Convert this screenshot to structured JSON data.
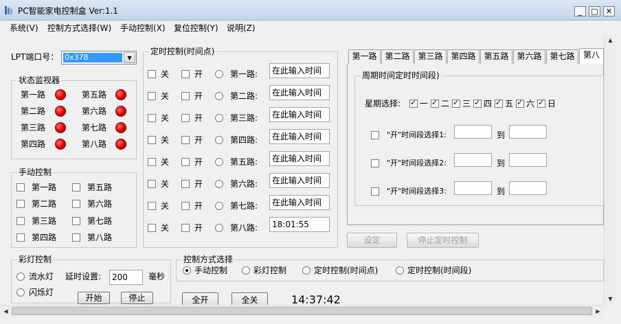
{
  "window": {
    "title": "PC智能家电控制盒  Ver:1.1",
    "minimize_icon": "minimize-icon",
    "maximize_icon": "maximize-icon",
    "close_icon": "close-icon",
    "min_glyph": "_",
    "max_glyph": "□",
    "close_glyph": "✕"
  },
  "menu": [
    "系统(V)",
    "控制方式选择(W)",
    "手动控制(X)",
    "复位控制(Y)",
    "说明(Z)"
  ],
  "lpt": {
    "label": "LPT端口号：",
    "value": "0x378",
    "arrow": "▼"
  },
  "status_monitor": {
    "title": "状态监视器",
    "channels": [
      "第一路",
      "第二路",
      "第三路",
      "第四路",
      "第五路",
      "第六路",
      "第七路",
      "第八路"
    ],
    "led_color": "#e00000"
  },
  "manual_control": {
    "title": "手动控制",
    "channels": [
      "第一路",
      "第二路",
      "第三路",
      "第四路",
      "第五路",
      "第六路",
      "第七路",
      "第八路"
    ]
  },
  "timer_point": {
    "title": "定时控制(时间点)",
    "off_label": "关",
    "on_label": "开",
    "rows": [
      {
        "channel": "第一路:",
        "value": "在此输入时间"
      },
      {
        "channel": "第二路:",
        "value": "在此输入时间"
      },
      {
        "channel": "第三路:",
        "value": "在此输入时间"
      },
      {
        "channel": "第四路:",
        "value": "在此输入时间"
      },
      {
        "channel": "第五路:",
        "value": "在此输入时间"
      },
      {
        "channel": "第六路:",
        "value": "在此输入时间"
      },
      {
        "channel": "第七路:",
        "value": "在此输入时间"
      },
      {
        "channel": "第八路:",
        "value": "18:01:55"
      }
    ]
  },
  "tabs": [
    "第一路",
    "第二路",
    "第三路",
    "第四路",
    "第五路",
    "第六路",
    "第七路",
    "第八路"
  ],
  "period": {
    "title": "周期时间定时时间段)",
    "weekday_label": "星期选择:",
    "weekdays": [
      "一",
      "二",
      "三",
      "四",
      "五",
      "六",
      "日"
    ],
    "to_label": "到",
    "rows": [
      "\"开\"时间段选择1:",
      "\"开\"时间段选择2:",
      "\"开\"时间段选择3:"
    ],
    "set_button": "设定",
    "stop_button": "停止定时控制"
  },
  "color_light": {
    "title": "彩灯控制",
    "flow_label": "流水灯",
    "flash_label": "闪烁灯",
    "delay_label": "延时设置:",
    "delay_value": "200",
    "unit": "毫秒",
    "start_button": "开始",
    "stop_button": "停止"
  },
  "mode": {
    "title": "控制方式选择",
    "options": [
      "手动控制",
      "彩灯控制",
      "定时控制(时间点)",
      "定时控制(时间段)"
    ],
    "selected": 0
  },
  "bottom": {
    "all_on": "全开",
    "all_off": "全关",
    "clock": "14:37:42"
  },
  "scroll": {
    "up": "▲",
    "down": "▼",
    "left": "◀",
    "right": "▶"
  }
}
